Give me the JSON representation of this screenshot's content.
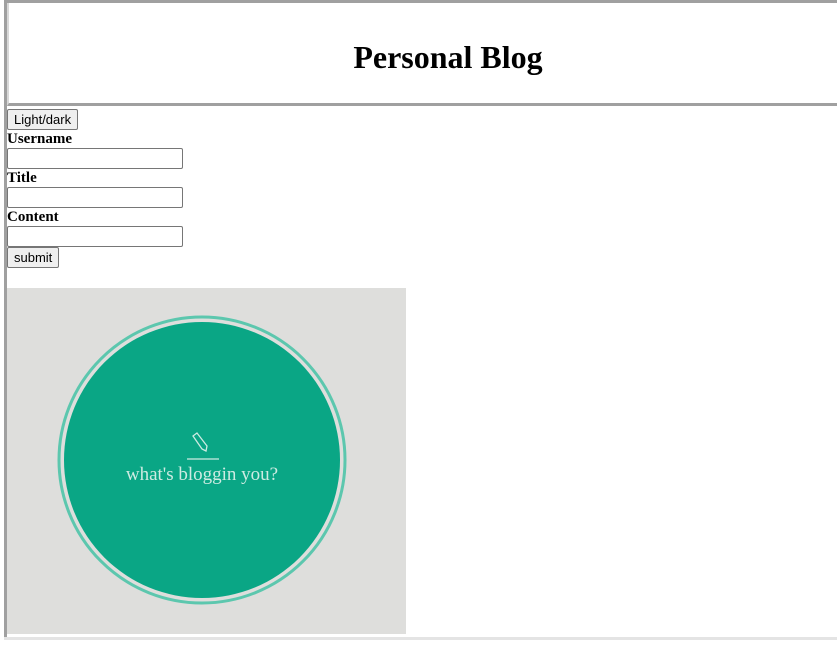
{
  "header": {
    "title": "Personal Blog"
  },
  "toggle": {
    "label": "Light/dark"
  },
  "form": {
    "username_label": "Username",
    "title_label": "Title",
    "content_label": "Content",
    "username_value": "",
    "title_value": "",
    "content_value": "",
    "submit_label": "submit"
  },
  "logo": {
    "text": "what's bloggin you?",
    "circle_color": "#0aa685",
    "background_color": "#dededc",
    "icon": "pen-icon"
  }
}
